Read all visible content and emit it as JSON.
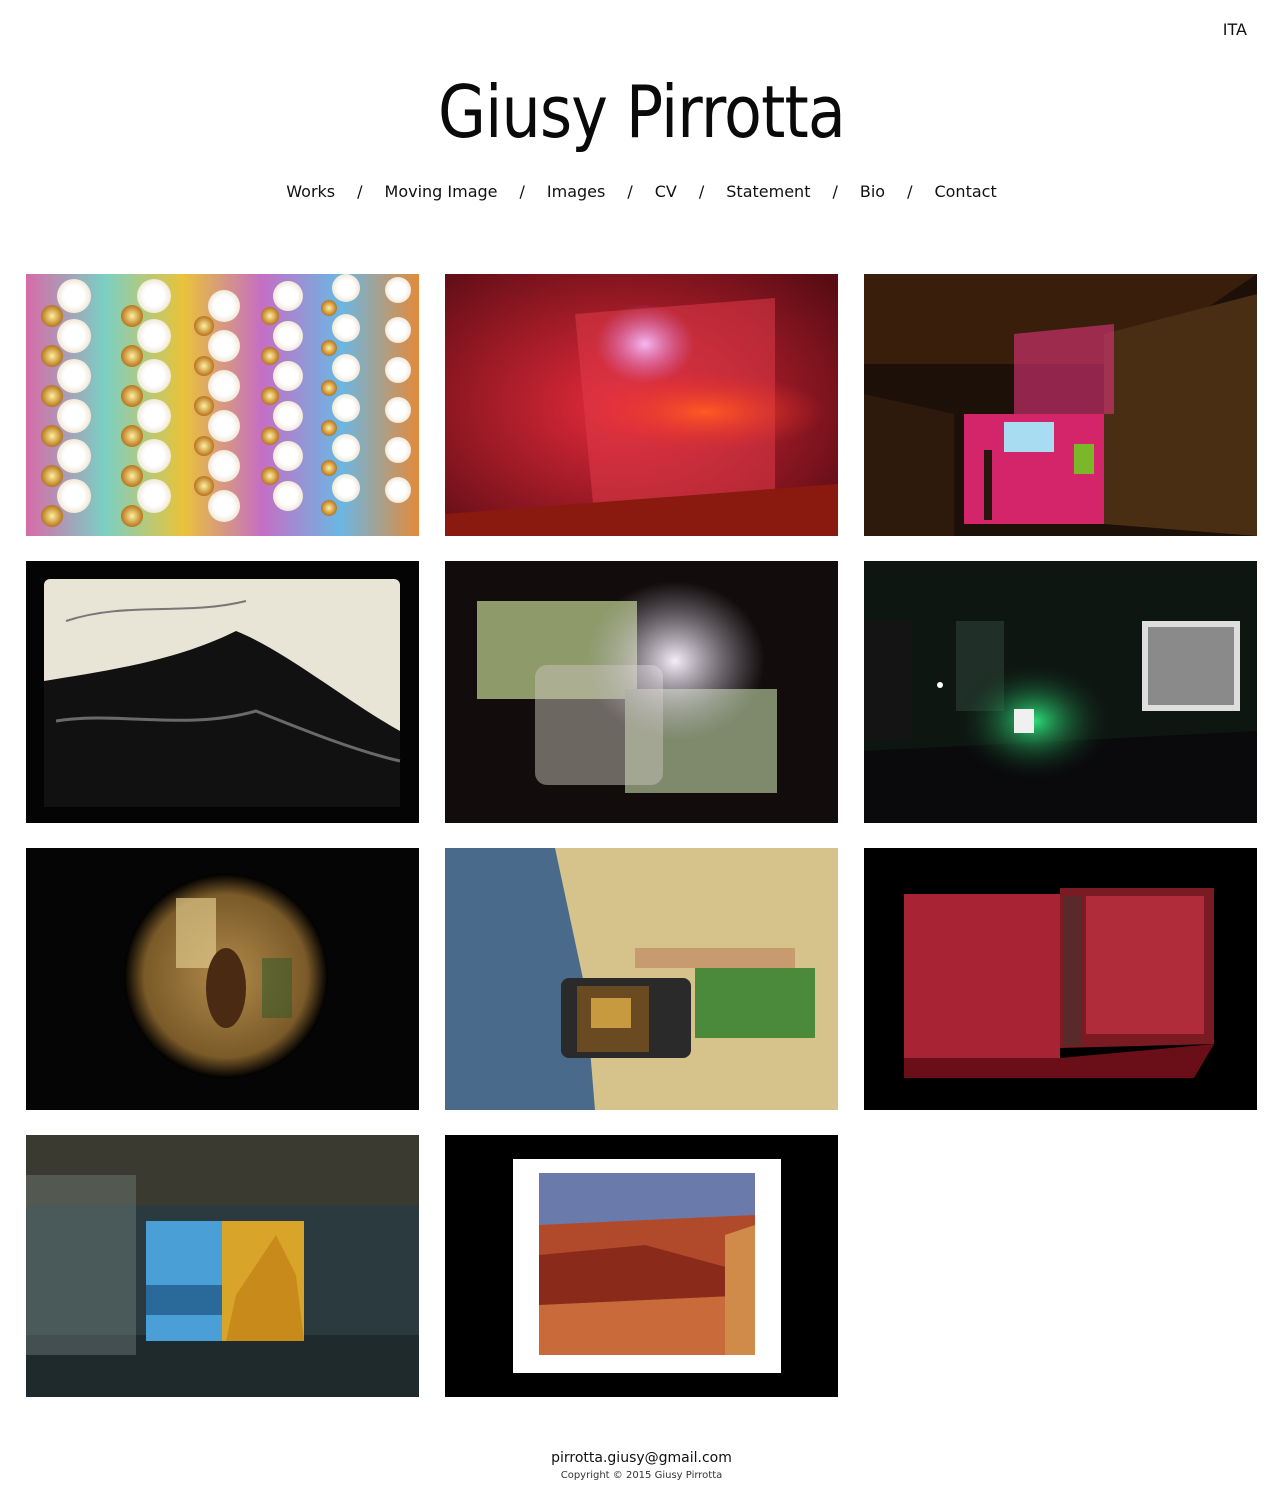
{
  "header": {
    "language_link": "ITA",
    "site_title": "Giusy Pirrotta"
  },
  "nav": {
    "items": [
      "Works",
      "Moving Image",
      "Images",
      "CV",
      "Statement",
      "Bio",
      "Contact"
    ],
    "separator": "/"
  },
  "gallery": {
    "tiles": [
      {
        "name": "light-bulbs-artwork",
        "colors": [
          "#f4b23c",
          "#ffffff",
          "#c86eaa"
        ]
      },
      {
        "name": "red-projection-room",
        "colors": [
          "#b31c2c",
          "#ff4a2a",
          "#e6a0e8"
        ]
      },
      {
        "name": "pink-corridor-installation",
        "colors": [
          "#241409",
          "#e0337a",
          "#5e4a2a"
        ]
      },
      {
        "name": "black-white-film-still",
        "colors": [
          "#050505",
          "#e8e4d4",
          "#1a1a1a"
        ]
      },
      {
        "name": "overlapping-projections",
        "colors": [
          "#120c0c",
          "#8e9a6a",
          "#d8cfe0"
        ]
      },
      {
        "name": "green-light-installation",
        "colors": [
          "#0e1410",
          "#2ee07a",
          "#e8e8e8"
        ]
      },
      {
        "name": "circular-viewer-image",
        "colors": [
          "#050505",
          "#d0a24a",
          "#6a4a1a"
        ]
      },
      {
        "name": "hula-dancers-projection",
        "colors": [
          "#4b6a8c",
          "#d6c38c",
          "#3d8a3a"
        ]
      },
      {
        "name": "red-rock-lightboxes",
        "colors": [
          "#000000",
          "#c22a3a",
          "#7a1a22"
        ]
      },
      {
        "name": "landscape-lightbox-ruin",
        "colors": [
          "#2a3a3e",
          "#4aa0d6",
          "#d8a52a"
        ]
      },
      {
        "name": "grand-canyon-print",
        "colors": [
          "#000000",
          "#ffffff",
          "#c84a2a"
        ]
      }
    ]
  },
  "footer": {
    "email": "pirrotta.giusy@gmail.com",
    "copyright": "Copyright © 2015 Giusy Pirrotta"
  }
}
